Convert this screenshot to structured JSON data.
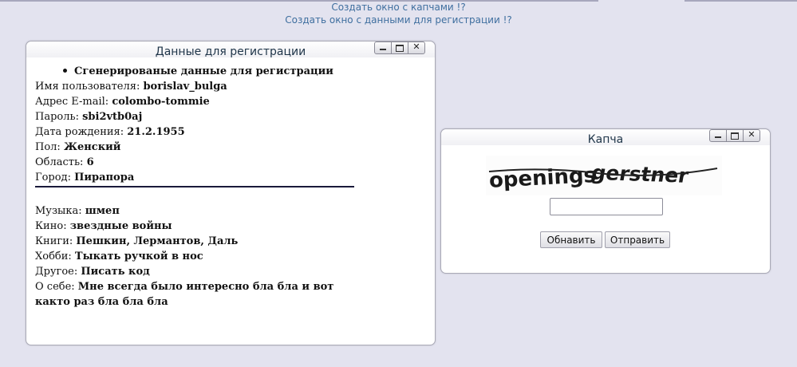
{
  "links": {
    "create_captcha": "Создать окно с капчами !?",
    "create_reg": "Создать окно с данными для регистрации !?"
  },
  "reg_window": {
    "title": "Данные для регистрации",
    "heading": "Сгенерированые данные для регистрации",
    "fields": [
      {
        "label": "Имя пользователя: ",
        "value": "borislav_bulga"
      },
      {
        "label": "Адрес E-mail: ",
        "value": "colombo-tommie"
      },
      {
        "label": "Пароль: ",
        "value": "sbi2vtb0aj"
      },
      {
        "label": "Дата рождения: ",
        "value": "21.2.1955"
      },
      {
        "label": "Пол: ",
        "value": "Женский"
      },
      {
        "label": "Область: ",
        "value": "6"
      },
      {
        "label": "Город: ",
        "value": "Пирапора"
      }
    ],
    "extra": [
      {
        "label": "Музыка: ",
        "value": "шмеп"
      },
      {
        "label": "Кино: ",
        "value": "звездные войны"
      },
      {
        "label": "Книги: ",
        "value": "Пешкин, Лермантов, Даль"
      },
      {
        "label": "Хобби: ",
        "value": "Тыкать ручкой в нос"
      },
      {
        "label": "Другое: ",
        "value": "Писать код"
      }
    ],
    "about_label": "О себе: ",
    "about_line1": "Мне всегда было интересно бла бла и вот",
    "about_line2": "както раз бла бла бла"
  },
  "captcha_window": {
    "title": "Капча",
    "captcha_text": "openings gerstner",
    "input_value": "",
    "refresh_label": "Обнавить",
    "submit_label": "Отправить"
  },
  "window_buttons": {
    "min": "minimize-icon",
    "max": "maximize-icon",
    "close": "close-icon",
    "close_glyph": "✕"
  }
}
